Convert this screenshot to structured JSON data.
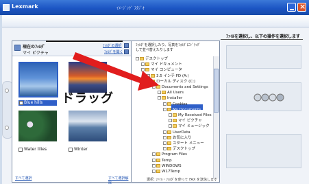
{
  "window": {
    "title": "Lexmark",
    "title_sub": "ｲﾒｰｼﾞﾝｸﾞ ｽﾀｼﾞｵ",
    "instruction": "ﾌｧｲﾙを選択し、以下の操作を選択します"
  },
  "thumbnails": {
    "current_folder_label": "現在のﾌｫﾙﾀﾞ",
    "current_folder_name": "マイ ピクチャ",
    "folder_select_link": "ﾌｫﾙﾀﾞの選択",
    "folder_open_link": "ﾌｫﾙﾀﾞを開く",
    "captions": [
      "Blue hills",
      "Water lilies",
      "Winter"
    ],
    "select_all": "すべて選択",
    "select_none": "すべて選択解除"
  },
  "tree": {
    "instruction_line1": "ﾌｫﾙﾀﾞを選択したり、写真をﾌｫﾙﾀﾞにﾄﾞﾗｯｸﾞ",
    "instruction_line2": "して並べ替えたりします",
    "items": [
      {
        "label": "デスクトップ",
        "indent": 0,
        "icon": "desktop-icon"
      },
      {
        "label": "マイ ドキュメント",
        "indent": 1,
        "icon": "folder-icon"
      },
      {
        "label": "マイ コンピュータ",
        "indent": 1,
        "icon": "computer-icon"
      },
      {
        "label": "3.5 インチ FD (A:)",
        "indent": 2,
        "icon": "floppy-icon"
      },
      {
        "label": "ローカル ディスク (C:)",
        "indent": 2,
        "icon": "drive-icon"
      },
      {
        "label": "Documents and Settings",
        "indent": 3,
        "icon": "folder-icon"
      },
      {
        "label": "All Users",
        "indent": 4,
        "icon": "folder-icon"
      },
      {
        "label": "Installer",
        "indent": 4,
        "icon": "folder-icon"
      },
      {
        "label": "Cookies",
        "indent": 5,
        "icon": "folder-icon"
      },
      {
        "label": "My Documents",
        "indent": 5,
        "icon": "folder-icon"
      },
      {
        "label": "My Received Files",
        "indent": 6,
        "icon": "folder-icon"
      },
      {
        "label": "マイ ピクチャ",
        "indent": 6,
        "icon": "folder-icon"
      },
      {
        "label": "マイ ミュージック",
        "indent": 6,
        "icon": "folder-icon"
      },
      {
        "label": "UserData",
        "indent": 5,
        "icon": "folder-icon"
      },
      {
        "label": "お気に入り",
        "indent": 5,
        "icon": "folder-icon"
      },
      {
        "label": "スタート メニュー",
        "indent": 5,
        "icon": "folder-icon"
      },
      {
        "label": "デスクトップ",
        "indent": 5,
        "icon": "folder-icon"
      },
      {
        "label": "Program Files",
        "indent": 3,
        "icon": "folder-icon"
      },
      {
        "label": "Temp",
        "indent": 3,
        "icon": "folder-icon"
      },
      {
        "label": "WINDOWS",
        "indent": 3,
        "icon": "folder-icon"
      },
      {
        "label": "W17Temp",
        "indent": 3,
        "icon": "folder-icon"
      }
    ],
    "bottom_text": "選択: ﾌｧｲﾙ・ﾌｫﾙﾀﾞを使って FAX を送信します"
  },
  "overlay": {
    "drag_label": "ドラッグ"
  }
}
